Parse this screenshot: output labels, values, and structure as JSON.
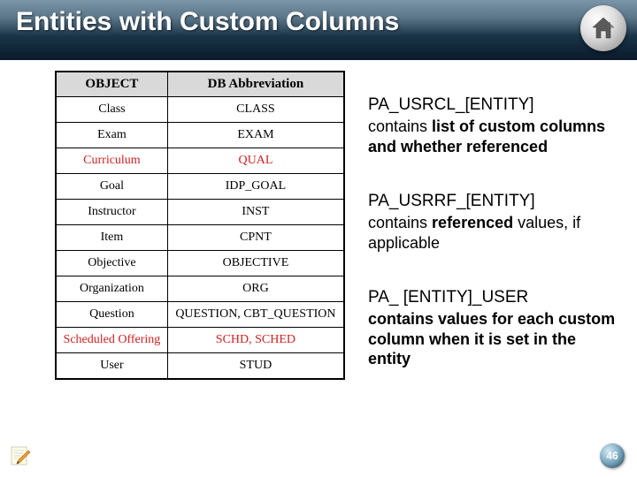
{
  "header": {
    "title": "Entities with Custom Columns"
  },
  "table": {
    "headers": {
      "col1": "OBJECT",
      "col2": "DB Abbreviation"
    },
    "rows": [
      {
        "obj": "Class",
        "abbr": "CLASS",
        "red": false
      },
      {
        "obj": "Exam",
        "abbr": "EXAM",
        "red": false
      },
      {
        "obj": "Curriculum",
        "abbr": "QUAL",
        "red": true
      },
      {
        "obj": "Goal",
        "abbr": "IDP_GOAL",
        "red": false
      },
      {
        "obj": "Instructor",
        "abbr": "INST",
        "red": false
      },
      {
        "obj": "Item",
        "abbr": "CPNT",
        "red": false
      },
      {
        "obj": "Objective",
        "abbr": "OBJECTIVE",
        "red": false
      },
      {
        "obj": "Organization",
        "abbr": "ORG",
        "red": false
      },
      {
        "obj": "Question",
        "abbr": "QUESTION, CBT_QUESTION",
        "red": false
      },
      {
        "obj": "Scheduled Offering",
        "abbr": "SCHD, SCHED",
        "red": true
      },
      {
        "obj": "User",
        "abbr": "STUD",
        "red": false
      }
    ]
  },
  "blocks": {
    "b1": {
      "title": "PA_USRCL_[ENTITY]",
      "body_pre": "contains ",
      "body_bold": "list of custom columns and whether referenced",
      "body_post": ""
    },
    "b2": {
      "title": "PA_USRRF_[ENTITY]",
      "body_pre": "contains ",
      "body_bold": "referenced",
      "body_post": " values, if applicable"
    },
    "b3": {
      "title": "PA_ [ENTITY]_USER",
      "body_pre": "",
      "body_bold": "contains values for each custom column when it is set in the entity",
      "body_post": ""
    }
  },
  "page_number": "46"
}
